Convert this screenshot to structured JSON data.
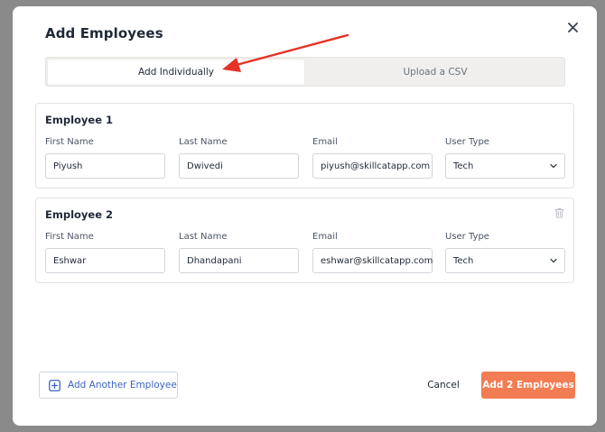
{
  "modal": {
    "title": "Add Employees"
  },
  "tabs": {
    "individual_label": "Add Individually",
    "csv_label": "Upload a CSV"
  },
  "labels": {
    "first_name": "First Name",
    "last_name": "Last Name",
    "email": "Email",
    "user_type": "User Type"
  },
  "employees": [
    {
      "title": "Employee 1",
      "first_name": "Piyush",
      "last_name": "Dwivedi",
      "email": "piyush@skillcatapp.com",
      "user_type": "Tech"
    },
    {
      "title": "Employee 2",
      "first_name": "Eshwar",
      "last_name": "Dhandapani",
      "email": "eshwar@skillcatapp.com",
      "user_type": "Tech"
    }
  ],
  "footer": {
    "add_another_label": "Add Another Employee",
    "cancel_label": "Cancel",
    "submit_label": "Add 2 Employees"
  },
  "icons": {
    "close": "close-icon",
    "arrow": "arrow-annotation",
    "trash": "trash-icon",
    "plus": "plus-square-icon",
    "chevron": "chevron-down-icon"
  },
  "colors": {
    "accent": "#f27d53",
    "link": "#3b63c4",
    "annotation_arrow": "#e53224"
  }
}
